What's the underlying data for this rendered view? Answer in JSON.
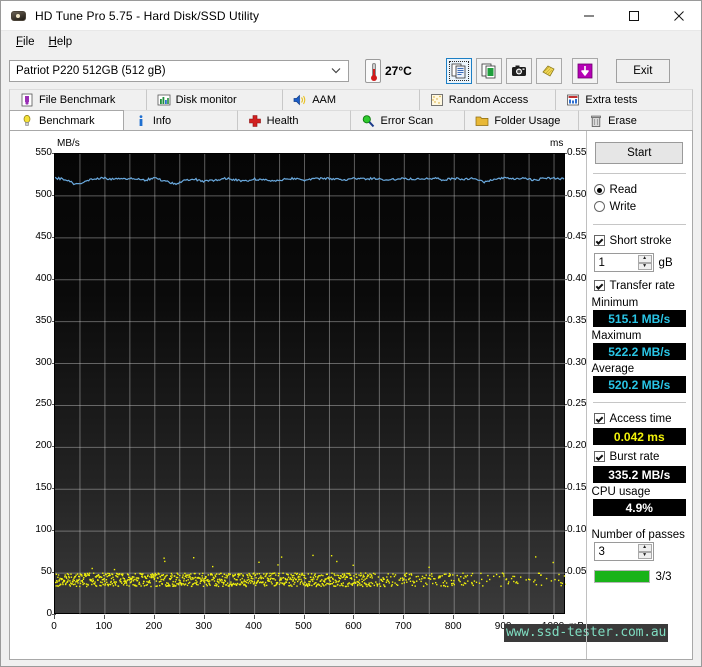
{
  "window": {
    "title": "HD Tune Pro 5.75 - Hard Disk/SSD Utility",
    "app_icon": "harddisk-icon",
    "minimize": "–",
    "maximize": "□",
    "close": "✕"
  },
  "menu": {
    "items": [
      {
        "label": "File",
        "mnemonic": "F",
        "rest": "ile"
      },
      {
        "label": "Help",
        "mnemonic": "H",
        "rest": "elp"
      }
    ]
  },
  "toolbar": {
    "drive_selected": "Patriot P220 512GB (512 gB)",
    "drive_chevron": "∨",
    "temperature": "27°C",
    "thermometer_icon": "thermometer-icon",
    "buttons": [
      {
        "name": "copy-to-clipboard-button",
        "icon": "copy-pages-icon"
      },
      {
        "name": "save-report-button",
        "icon": "save-document-icon"
      },
      {
        "name": "screenshot-button",
        "icon": "camera-icon"
      },
      {
        "name": "gloves-button",
        "icon": "gloves-icon"
      },
      {
        "name": "download-button",
        "icon": "download-arrow-icon"
      }
    ],
    "exit_label": "Exit"
  },
  "tabs": {
    "row1": [
      {
        "label": "File Benchmark",
        "icon": "file-benchmark-icon",
        "selected": false
      },
      {
        "label": "Disk monitor",
        "icon": "disk-monitor-icon",
        "selected": false
      },
      {
        "label": "AAM",
        "icon": "speaker-icon",
        "selected": false
      },
      {
        "label": "Random Access",
        "icon": "random-access-icon",
        "selected": false
      },
      {
        "label": "Extra tests",
        "icon": "extra-tests-icon",
        "selected": false
      }
    ],
    "row2": [
      {
        "label": "Benchmark",
        "icon": "lightbulb-icon",
        "selected": true
      },
      {
        "label": "Info",
        "icon": "info-icon",
        "selected": false
      },
      {
        "label": "Health",
        "icon": "health-cross-icon",
        "selected": false
      },
      {
        "label": "Error Scan",
        "icon": "magnifier-icon",
        "selected": false
      },
      {
        "label": "Folder Usage",
        "icon": "folder-icon",
        "selected": false
      },
      {
        "label": "Erase",
        "icon": "trash-icon",
        "selected": false
      }
    ]
  },
  "panel": {
    "start_label": "Start",
    "mode": {
      "read_label": "Read",
      "write_label": "Write",
      "read_selected": true,
      "write_selected": false
    },
    "short_stroke": {
      "label": "Short stroke",
      "checked": true,
      "value": "1",
      "unit": "gB"
    },
    "transfer_rate": {
      "label": "Transfer rate",
      "checked": true,
      "minimum_label": "Minimum",
      "minimum_value": "515.1 MB/s",
      "maximum_label": "Maximum",
      "maximum_value": "522.2 MB/s",
      "average_label": "Average",
      "average_value": "520.2 MB/s"
    },
    "access_time": {
      "label": "Access time",
      "checked": true,
      "value": "0.042 ms"
    },
    "burst_rate": {
      "label": "Burst rate",
      "checked": true,
      "value": "335.2 MB/s"
    },
    "cpu_usage": {
      "label": "CPU usage",
      "value": "4.9%"
    },
    "passes": {
      "label": "Number of passes",
      "value": "3",
      "progress_text": "3/3",
      "progress_percent": 100,
      "progress_color": "#19b319"
    }
  },
  "chart_data": {
    "type": "line",
    "title": "",
    "xlabel": "mB",
    "ylabel": "MB/s",
    "y2label": "ms",
    "xlim": [
      0,
      1024
    ],
    "ylim": [
      0,
      550
    ],
    "y2lim": [
      0,
      0.55
    ],
    "grid": true,
    "xticks": [
      0,
      100,
      200,
      300,
      400,
      500,
      600,
      700,
      800,
      900,
      1000
    ],
    "yticks": [
      0,
      50,
      100,
      150,
      200,
      250,
      300,
      350,
      400,
      450,
      500,
      550
    ],
    "y2ticks": [
      "0.05",
      "0.10",
      "0.15",
      "0.20",
      "0.25",
      "0.30",
      "0.35",
      "0.40",
      "0.45",
      "0.50",
      "0.55"
    ],
    "legend_position": "none",
    "background": "#0a0a0a",
    "series": [
      {
        "name": "Transfer rate",
        "type": "line",
        "color": "#6aa9dd",
        "axis": "left",
        "unit": "MB/s",
        "x": [
          0,
          20,
          40,
          60,
          80,
          100,
          120,
          140,
          160,
          180,
          200,
          220,
          240,
          260,
          280,
          300,
          320,
          340,
          360,
          380,
          400,
          420,
          440,
          460,
          480,
          500,
          520,
          540,
          560,
          580,
          600,
          620,
          640,
          660,
          680,
          700,
          720,
          740,
          760,
          780,
          800,
          820,
          840,
          860,
          880,
          900,
          920,
          940,
          960,
          980,
          1000,
          1020
        ],
        "values": [
          521,
          520,
          514,
          517,
          521,
          521,
          520,
          521,
          520,
          519,
          521,
          518,
          514,
          518,
          520,
          517,
          519,
          521,
          519,
          518,
          520,
          519,
          518,
          520,
          521,
          519,
          520,
          521,
          520,
          519,
          521,
          520,
          521,
          519,
          520,
          521,
          520,
          521,
          521,
          519,
          521,
          520,
          521,
          516,
          520,
          521,
          520,
          521,
          519,
          521,
          521,
          520
        ]
      },
      {
        "name": "Access time",
        "type": "scatter",
        "color": "#f2f20a",
        "axis": "right",
        "unit": "ms",
        "mean": 0.042,
        "range": [
          0.03,
          0.075
        ],
        "note": "dense yellow scatter near 0.04 ms across the full span, thinning after ~700 mB"
      }
    ]
  },
  "watermark": {
    "text": "www.ssd-tester.com.au"
  }
}
